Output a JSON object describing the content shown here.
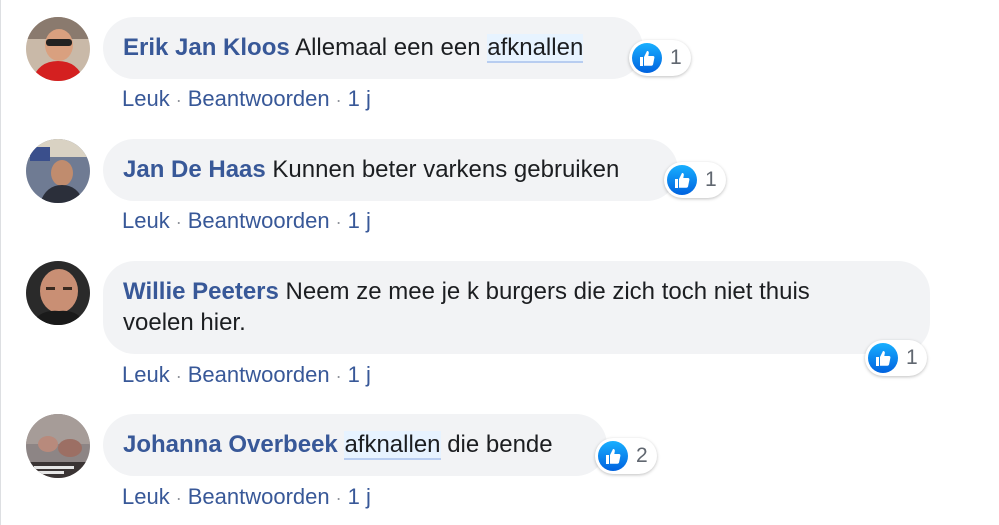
{
  "comments": [
    {
      "author": "Erik Jan Kloos",
      "text_before": "Allemaal een een",
      "tag": "afknallen",
      "text_after": "",
      "text_line2": "",
      "reaction_count": "1",
      "actions": {
        "like": "Leuk",
        "reply": "Beantwoorden",
        "time": "1 j"
      },
      "avatar_icon": "user-avatar"
    },
    {
      "author": "Jan De Haas",
      "text_before": "Kunnen beter varkens gebruiken",
      "tag": "",
      "text_after": "",
      "text_line2": "",
      "reaction_count": "1",
      "actions": {
        "like": "Leuk",
        "reply": "Beantwoorden",
        "time": "1 j"
      },
      "avatar_icon": "user-avatar"
    },
    {
      "author": "Willie Peeters",
      "text_before": "Neem ze mee je k burgers die zich toch niet thuis",
      "tag": "",
      "text_after": "",
      "text_line2": "voelen hier.",
      "reaction_count": "1",
      "actions": {
        "like": "Leuk",
        "reply": "Beantwoorden",
        "time": "1 j"
      },
      "avatar_icon": "user-avatar"
    },
    {
      "author": "Johanna Overbeek",
      "text_before": "",
      "tag": "afknallen",
      "text_after": "die bende",
      "text_line2": "",
      "reaction_count": "2",
      "actions": {
        "like": "Leuk",
        "reply": "Beantwoorden",
        "time": "1 j"
      },
      "avatar_icon": "user-avatar"
    }
  ],
  "separator": "·",
  "colors": {
    "author": "#385898",
    "bubble": "#f2f3f5",
    "like_blue": "#1877f2",
    "tag_bg": "#e7f3ff"
  }
}
